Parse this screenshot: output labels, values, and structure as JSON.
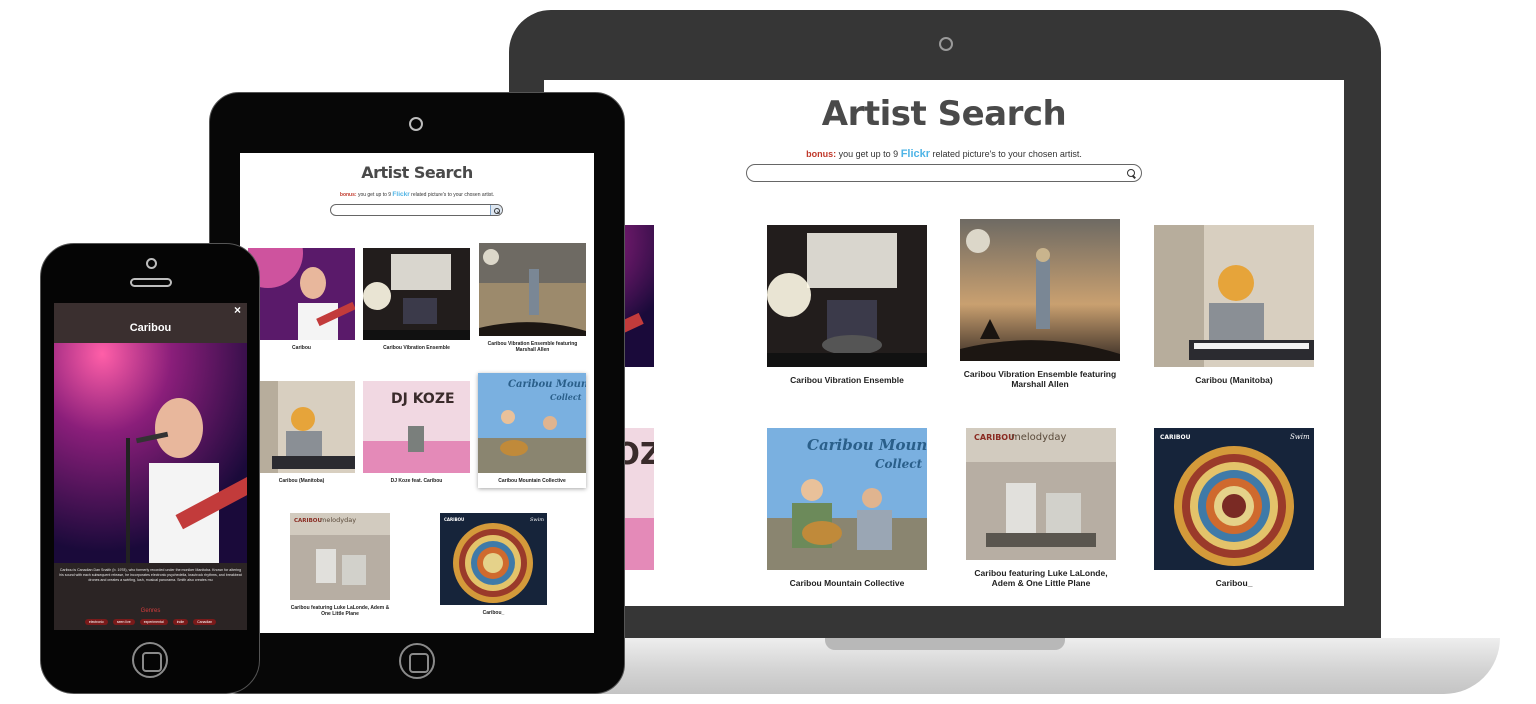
{
  "app": {
    "title": "Artist Search",
    "bonus_label": "bonus:",
    "bonus_pre": " you get up to 9 ",
    "flickr": "Flickr",
    "bonus_post": " related picture's to your chosen artist.",
    "search_placeholder": ""
  },
  "results": [
    {
      "caption": "Caribou",
      "art": "concert-pink"
    },
    {
      "caption": "Caribou Vibration Ensemble",
      "art": "stage-band"
    },
    {
      "caption": "Caribou Vibration Ensemble featuring Marshall Allen",
      "art": "sunset-cover"
    },
    {
      "caption": "Caribou (Manitoba)",
      "art": "mask-keyboard"
    },
    {
      "caption": "DJ Koze feat. Caribou",
      "art": "djkoze-cover"
    },
    {
      "caption": "Caribou Mountain Collective",
      "art": "mountain-band"
    },
    {
      "caption": "Caribou featuring Luke LaLonde, Adem & One Little Plane",
      "art": "melodyday-cover"
    },
    {
      "caption": "Caribou_",
      "art": "swim-cover"
    }
  ],
  "laptop_captions": {
    "item0": "Caribou",
    "item4": "J Koze feat. Caribou"
  },
  "cover_text": {
    "djkoze": "DJ KOZE",
    "mountain": "Caribou Moun",
    "mountain2": "Collect",
    "melodyday_a": "CARIBOU",
    "melodyday_b": "melodyday",
    "swim_a": "CARIBOU",
    "swim_b": "Swim"
  },
  "modal": {
    "title": "Caribou",
    "close": "×",
    "bio": "Caribou is Canadian Dan Snaith (b. 1978), who formerly recorded under the moniker Manitoba. Known for altering his sound with each subsequent release, he incorporates electronic psychedelia, krautrock rhythms, and breakbeat drones and creates a swirling, lush, musical panorama. Smith also creates mu",
    "genres_title": "Genres",
    "genres": [
      "electronic",
      "seen live",
      "experimental",
      "indie",
      "Canadian"
    ]
  },
  "colors": {
    "bonus": "#c0392b",
    "flickr": "#4fb4e6",
    "genre_title": "#d23c3c",
    "modal_header": "#3a2f2f"
  }
}
